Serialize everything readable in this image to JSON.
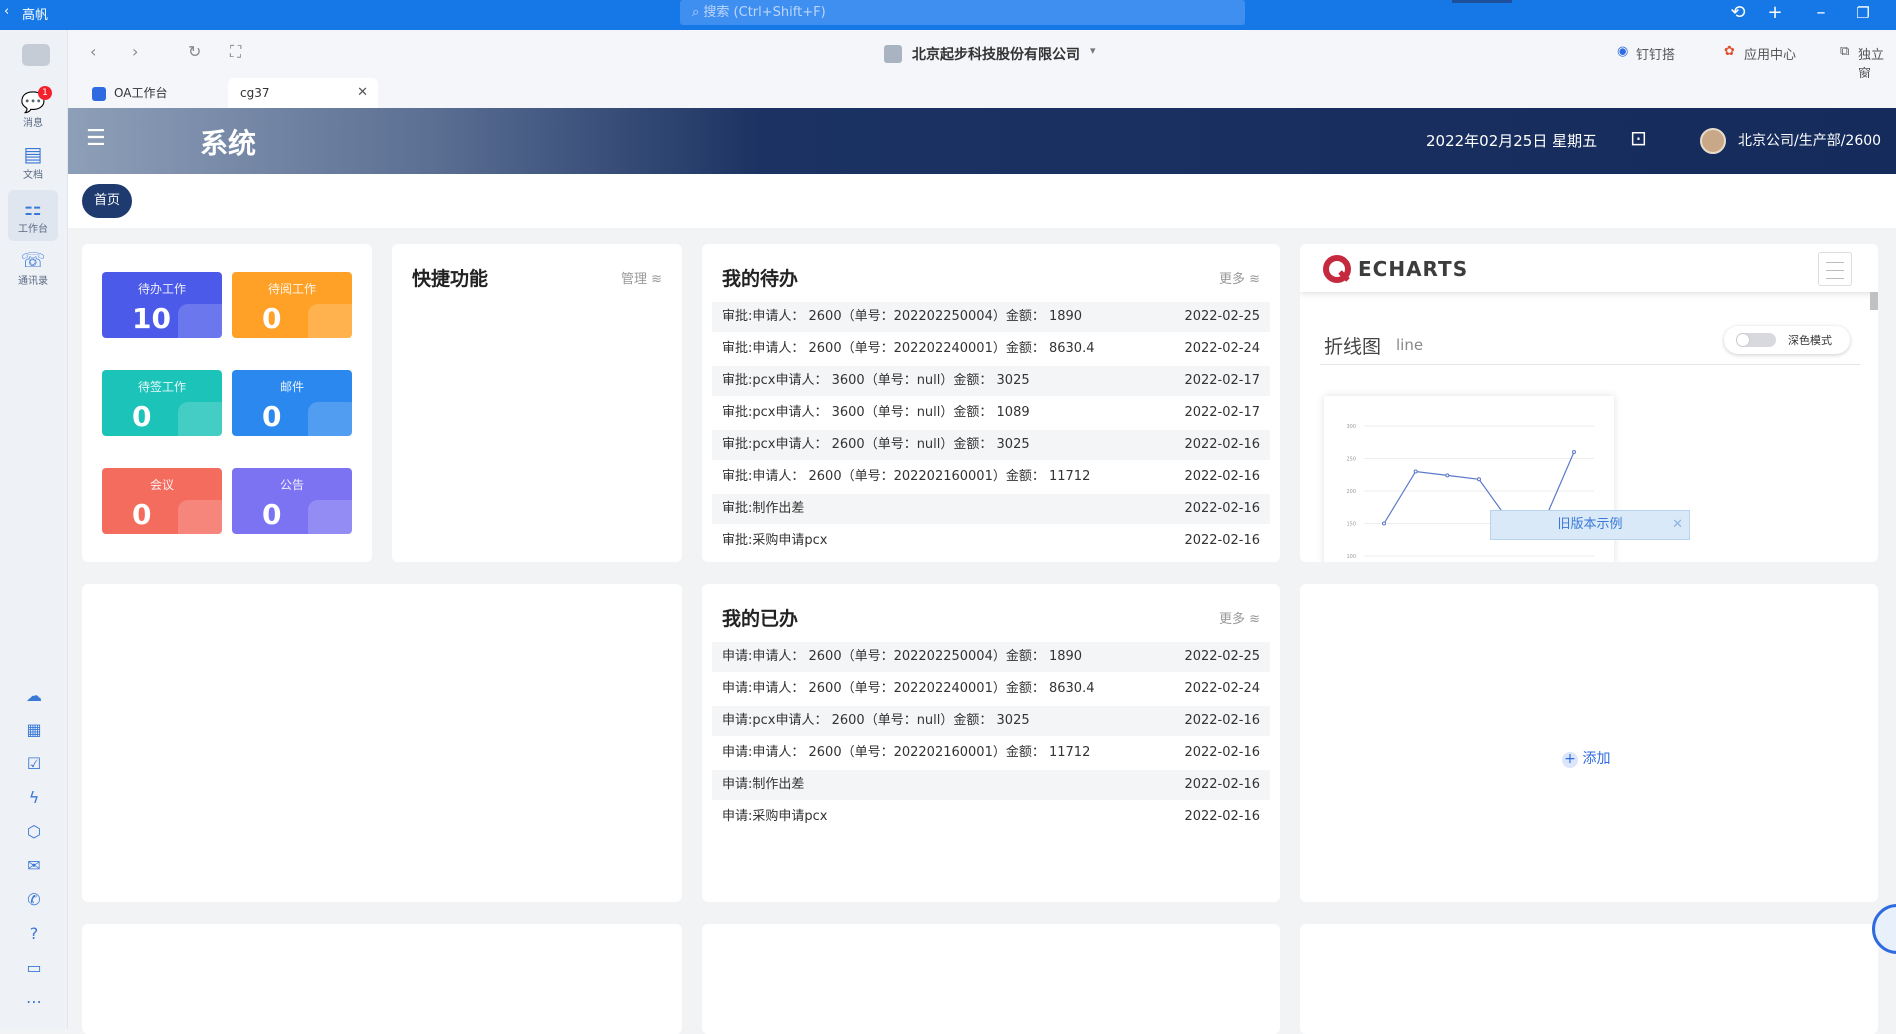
{
  "titlebar": {
    "app_name": "高帆",
    "search_placeholder": "搜索 (Ctrl+Shift+F)"
  },
  "rail": {
    "items": [
      {
        "label": "消息",
        "icon": "message-icon",
        "badge": "1"
      },
      {
        "label": "文档",
        "icon": "doc-icon"
      },
      {
        "label": "工作台",
        "icon": "workbench-icon"
      },
      {
        "label": "通讯录",
        "icon": "contacts-icon"
      }
    ],
    "more": "⋯"
  },
  "navbar": {
    "company": "北京起步科技股份有限公司",
    "dingpan": "钉钉搭",
    "app_center": "应用中心",
    "standalone": "独立窗"
  },
  "tabs": [
    {
      "label": "OA工作台"
    },
    {
      "label": "cg37"
    }
  ],
  "header": {
    "system": "系统",
    "date": "2022年02月25日 星期五",
    "user": "北京公司/生产部/2600"
  },
  "breadcrumb": {
    "home": "首页"
  },
  "tiles": [
    {
      "label": "待办工作",
      "value": "10",
      "color": "#4b5ae8"
    },
    {
      "label": "待阅工作",
      "value": "0",
      "color": "#ffa126"
    },
    {
      "label": "待签工作",
      "value": "0",
      "color": "#1cc3b8"
    },
    {
      "label": "邮件",
      "value": "0",
      "color": "#2b88ee"
    },
    {
      "label": "会议",
      "value": "0",
      "color": "#f46c5e"
    },
    {
      "label": "公告",
      "value": "0",
      "color": "#7c73f3"
    }
  ],
  "quick": {
    "title": "快捷功能",
    "manage": "管理"
  },
  "todo": {
    "title": "我的待办",
    "more": "更多",
    "rows": [
      {
        "text": "审批:申请人： 2600（单号：202202250004）金额： 1890",
        "date": "2022-02-25"
      },
      {
        "text": "审批:申请人： 2600（单号：202202240001）金额： 8630.4",
        "date": "2022-02-24"
      },
      {
        "text": "审批:pcx申请人： 3600（单号：null）金额： 3025",
        "date": "2022-02-17"
      },
      {
        "text": "审批:pcx申请人： 3600（单号：null）金额： 1089",
        "date": "2022-02-17"
      },
      {
        "text": "审批:pcx申请人： 2600（单号：null）金额： 3025",
        "date": "2022-02-16"
      },
      {
        "text": "审批:申请人： 2600（单号：202202160001）金额： 11712",
        "date": "2022-02-16"
      },
      {
        "text": "审批:制作出差",
        "date": "2022-02-16"
      },
      {
        "text": "审批:采购申请pcx",
        "date": "2022-02-16"
      }
    ]
  },
  "done": {
    "title": "我的已办",
    "more": "更多",
    "rows": [
      {
        "text": "申请:申请人： 2600（单号：202202250004）金额： 1890",
        "date": "2022-02-25"
      },
      {
        "text": "申请:申请人： 2600（单号：202202240001）金额： 8630.4",
        "date": "2022-02-24"
      },
      {
        "text": "申请:pcx申请人： 2600（单号：null）金额： 3025",
        "date": "2022-02-16"
      },
      {
        "text": "申请:申请人： 2600（单号：202202160001）金额： 11712",
        "date": "2022-02-16"
      },
      {
        "text": "申请:制作出差",
        "date": "2022-02-16"
      },
      {
        "text": "申请:采购申请pcx",
        "date": "2022-02-16"
      }
    ]
  },
  "echarts": {
    "logo": "ECHARTS",
    "heading": "折线图",
    "sub": "line",
    "dark_mode": "深色模式",
    "old_version": "旧版本示例",
    "chart_data": {
      "type": "line",
      "y_ticks": [
        "300",
        "250",
        "200",
        "150",
        "100"
      ],
      "ylim": [
        100,
        300
      ],
      "values": [
        150,
        230,
        224,
        218,
        150,
        147,
        260
      ]
    }
  },
  "add": {
    "label": "添加"
  }
}
